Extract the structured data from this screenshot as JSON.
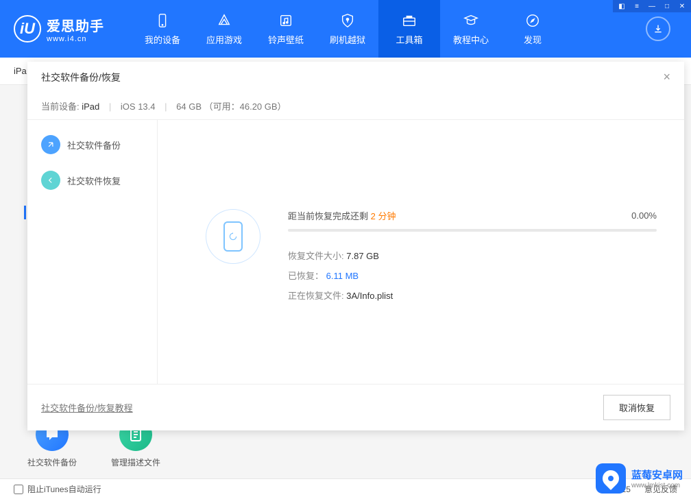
{
  "app": {
    "logo_title": "爱思助手",
    "logo_sub": "www.i4.cn"
  },
  "nav": [
    {
      "label": "我的设备",
      "icon": "device"
    },
    {
      "label": "应用游戏",
      "icon": "apps"
    },
    {
      "label": "铃声壁纸",
      "icon": "ringtone"
    },
    {
      "label": "刷机越狱",
      "icon": "jailbreak"
    },
    {
      "label": "工具箱",
      "icon": "toolbox"
    },
    {
      "label": "教程中心",
      "icon": "tutorial"
    },
    {
      "label": "发现",
      "icon": "discover"
    }
  ],
  "subheader": {
    "tab": "iPa"
  },
  "modal": {
    "title": "社交软件备份/恢复",
    "device": {
      "label": "当前设备:",
      "name": "iPad",
      "os": "iOS 13.4",
      "storage": "64 GB （可用：46.20 GB）"
    },
    "sidebar": [
      {
        "label": "社交软件备份",
        "color": "blue"
      },
      {
        "label": "社交软件恢复",
        "color": "cyan"
      }
    ],
    "progress": {
      "prefix": "距当前恢复完成还剩",
      "time": "2 分钟",
      "percent": "0.00%"
    },
    "info": {
      "size_label": "恢复文件大小:",
      "size_value": "7.87 GB",
      "done_label": "已恢复：",
      "done_value": "6.11 MB",
      "file_label": "正在恢复文件:",
      "file_value": "3A/Info.plist"
    },
    "footer": {
      "tutorial": "社交软件备份/恢复教程",
      "cancel": "取消恢复"
    }
  },
  "bottom_items": [
    {
      "label": "社交软件备份"
    },
    {
      "label": "管理描述文件"
    }
  ],
  "statusbar": {
    "checkbox": "阻止iTunes自动运行",
    "version": "V7.98.15",
    "feedback": "意见反馈"
  },
  "watermark": {
    "title": "蓝莓安卓网",
    "sub": "www.lmkjst.com"
  }
}
